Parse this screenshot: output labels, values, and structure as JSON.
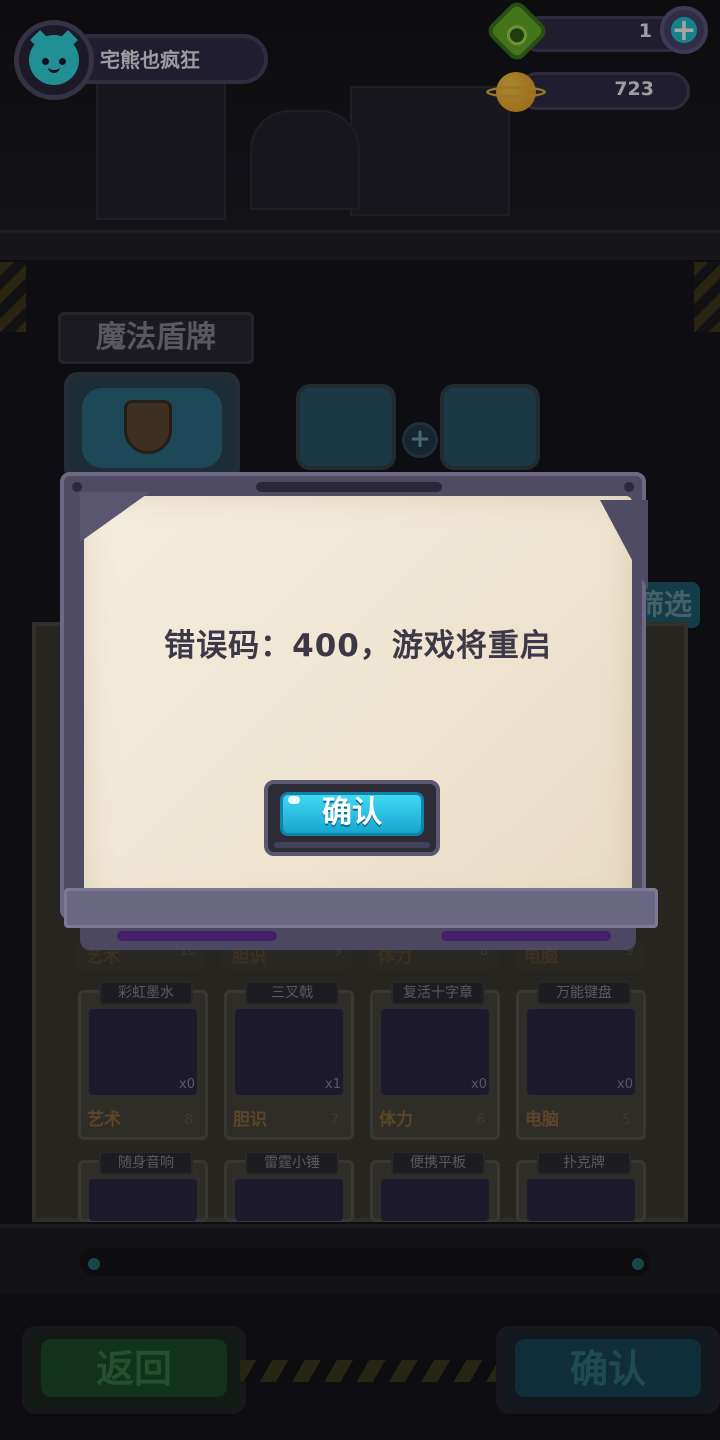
{
  "hud": {
    "player_name": "宅熊也疯狂",
    "currency_1_value": "1",
    "currency_2_value": "723",
    "add_label": "+"
  },
  "background": {
    "section_title": "魔法盾牌",
    "filter_label": "筛选",
    "slot_plus": "+",
    "partial_row": [
      {
        "stat": "艺术",
        "value": "10"
      },
      {
        "stat": "胆识",
        "value": "9"
      },
      {
        "stat": "体力",
        "value": "8"
      },
      {
        "stat": "电脑",
        "value": "9"
      }
    ],
    "items_row_1": [
      {
        "name": "彩虹墨水",
        "count": "x0",
        "stat": "艺术",
        "value": "8"
      },
      {
        "name": "三叉戟",
        "count": "x1",
        "stat": "胆识",
        "value": "7"
      },
      {
        "name": "复活十字章",
        "count": "x0",
        "stat": "体力",
        "value": "6"
      },
      {
        "name": "万能键盘",
        "count": "x0",
        "stat": "电脑",
        "value": "5"
      }
    ],
    "items_row_2": [
      {
        "name": "随身音响"
      },
      {
        "name": "雷霆小锤"
      },
      {
        "name": "便携平板"
      },
      {
        "name": "扑克牌"
      }
    ],
    "back_button": "返回",
    "confirm_button": "确认"
  },
  "dialog": {
    "message": "错误码：400，游戏将重启",
    "confirm_label": "确认"
  },
  "colors": {
    "accent_cyan": "#22c6d6",
    "confirm_blue": "#18a5cf",
    "paper": "#f2eadb",
    "frame_purple": "#4e4b63"
  }
}
